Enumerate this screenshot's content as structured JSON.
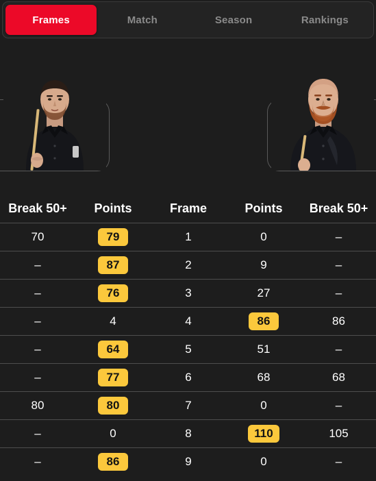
{
  "tabs": [
    {
      "label": "Frames",
      "active": true
    },
    {
      "label": "Match",
      "active": false
    },
    {
      "label": "Season",
      "active": false
    },
    {
      "label": "Rankings",
      "active": false
    }
  ],
  "players": {
    "left": {
      "description": "snooker player with short dark hair, beard, black shirt, holding cue"
    },
    "right": {
      "description": "bald snooker player with red beard, black shirt, holding cue"
    }
  },
  "table": {
    "headers": [
      "Break 50+",
      "Points",
      "Frame",
      "Points",
      "Break 50+"
    ],
    "rows": [
      {
        "break_left": "70",
        "points_left": "79",
        "points_left_win": true,
        "frame": "1",
        "points_right": "0",
        "points_right_win": false,
        "break_right": "–"
      },
      {
        "break_left": "–",
        "points_left": "87",
        "points_left_win": true,
        "frame": "2",
        "points_right": "9",
        "points_right_win": false,
        "break_right": "–"
      },
      {
        "break_left": "–",
        "points_left": "76",
        "points_left_win": true,
        "frame": "3",
        "points_right": "27",
        "points_right_win": false,
        "break_right": "–"
      },
      {
        "break_left": "–",
        "points_left": "4",
        "points_left_win": false,
        "frame": "4",
        "points_right": "86",
        "points_right_win": true,
        "break_right": "86"
      },
      {
        "break_left": "–",
        "points_left": "64",
        "points_left_win": true,
        "frame": "5",
        "points_right": "51",
        "points_right_win": false,
        "break_right": "–"
      },
      {
        "break_left": "–",
        "points_left": "77",
        "points_left_win": true,
        "frame": "6",
        "points_right": "68",
        "points_right_win": false,
        "break_right": "68"
      },
      {
        "break_left": "80",
        "points_left": "80",
        "points_left_win": true,
        "frame": "7",
        "points_right": "0",
        "points_right_win": false,
        "break_right": "–"
      },
      {
        "break_left": "–",
        "points_left": "0",
        "points_left_win": false,
        "frame": "8",
        "points_right": "110",
        "points_right_win": true,
        "break_right": "105"
      },
      {
        "break_left": "–",
        "points_left": "86",
        "points_left_win": true,
        "frame": "9",
        "points_right": "0",
        "points_right_win": false,
        "break_right": "–"
      }
    ]
  },
  "colors": {
    "background": "#1d1d1d",
    "active_tab": "#ec0928",
    "badge": "#fbc83c",
    "divider": "#4e4e4e",
    "inactive_tab_text": "#8a8a8a"
  }
}
